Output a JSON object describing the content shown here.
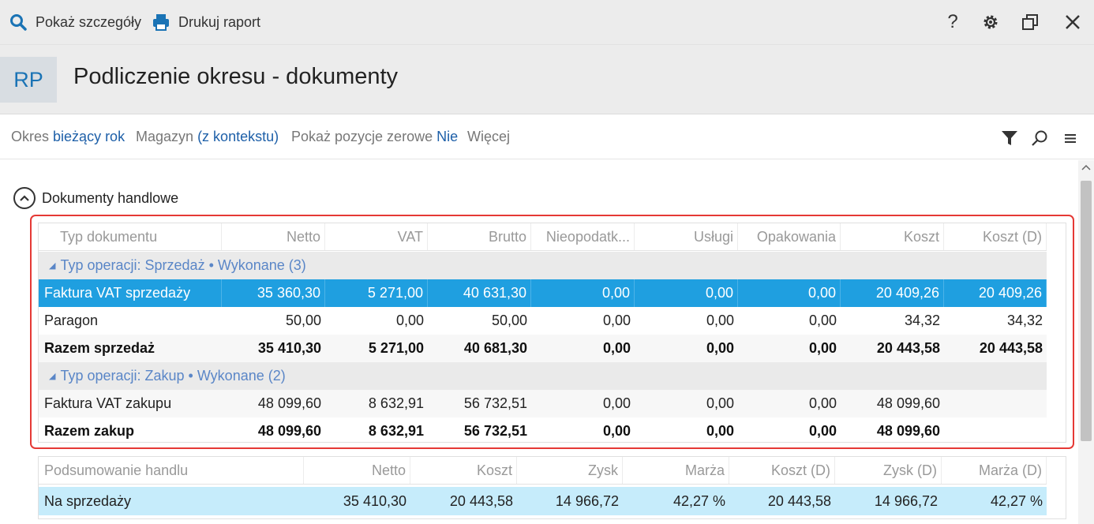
{
  "toolbar": {
    "details_label": "Pokaż szczegóły",
    "print_label": "Drukuj raport"
  },
  "header": {
    "badge": "RP",
    "title": "Podliczenie okresu - dokumenty"
  },
  "filters": {
    "period_label": "Okres",
    "period_value": "bieżący rok",
    "warehouse_label": "Magazyn",
    "warehouse_value": "(z kontekstu)",
    "zero_label": "Pokaż pozycje zerowe",
    "zero_value": "Nie",
    "more_label": "Więcej"
  },
  "section": {
    "title": "Dokumenty handlowe"
  },
  "documents": {
    "columns": [
      "Typ dokumentu",
      "Netto",
      "VAT",
      "Brutto",
      "Nieopodatk...",
      "Usługi",
      "Opakowania",
      "Koszt",
      "Koszt (D)"
    ],
    "group_sales": "Typ operacji: Sprzedaż • Wykonane (3)",
    "sales_rows": [
      [
        "Faktura VAT sprzedaży",
        "35 360,30",
        "5 271,00",
        "40 631,30",
        "0,00",
        "0,00",
        "0,00",
        "20 409,26",
        "20 409,26"
      ],
      [
        "Paragon",
        "50,00",
        "0,00",
        "50,00",
        "0,00",
        "0,00",
        "0,00",
        "34,32",
        "34,32"
      ]
    ],
    "sales_total": [
      "Razem sprzedaż",
      "35 410,30",
      "5 271,00",
      "40 681,30",
      "0,00",
      "0,00",
      "0,00",
      "20 443,58",
      "20 443,58"
    ],
    "group_purchase": "Typ operacji: Zakup • Wykonane (2)",
    "purchase_rows": [
      [
        "Faktura VAT zakupu",
        "48 099,60",
        "8 632,91",
        "56 732,51",
        "0,00",
        "0,00",
        "0,00",
        "48 099,60",
        ""
      ]
    ],
    "purchase_total": [
      "Razem zakup",
      "48 099,60",
      "8 632,91",
      "56 732,51",
      "0,00",
      "0,00",
      "0,00",
      "48 099,60",
      ""
    ]
  },
  "summary": {
    "columns": [
      "Podsumowanie handlu",
      "Netto",
      "Koszt",
      "Zysk",
      "Marża",
      "Koszt (D)",
      "Zysk (D)",
      "Marża (D)"
    ],
    "rows": [
      [
        "Na sprzedaży",
        "35 410,30",
        "20 443,58",
        "14 966,72",
        "42,27 %",
        "20 443,58",
        "14 966,72",
        "42,27 %"
      ]
    ]
  },
  "colors": {
    "accent": "#1f9fe0",
    "link": "#1d5fa8",
    "highlight": "#e53935",
    "summary_row": "#c6ecfb"
  }
}
